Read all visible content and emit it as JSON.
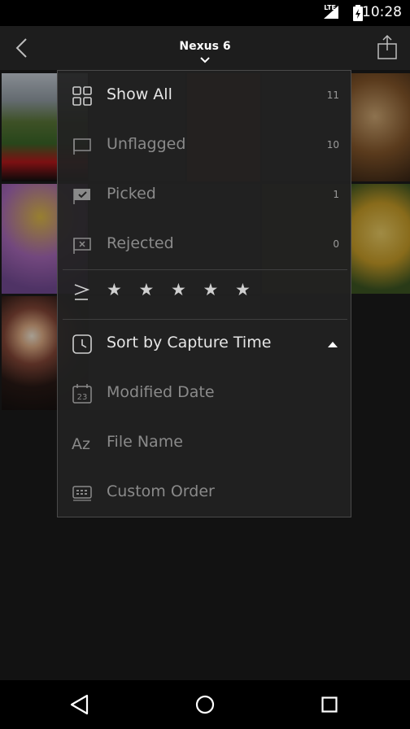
{
  "status": {
    "time": "10:28",
    "network": "LTE"
  },
  "header": {
    "title": "Nexus 6"
  },
  "filter_menu": {
    "items": [
      {
        "label": "Show All",
        "count": "11"
      },
      {
        "label": "Unflagged",
        "count": "10"
      },
      {
        "label": "Picked",
        "count": "1"
      },
      {
        "label": "Rejected",
        "count": "0"
      }
    ],
    "rating": {
      "stars": "★ ★ ★ ★ ★"
    }
  },
  "sort_menu": {
    "items": [
      {
        "label": "Sort by Capture Time"
      },
      {
        "label": "Modified Date"
      },
      {
        "label": "File Name"
      },
      {
        "label": "Custom Order"
      }
    ]
  },
  "colors": {
    "background": "#1d1d1d",
    "menu": "#212121",
    "statusbar": "#000000"
  }
}
